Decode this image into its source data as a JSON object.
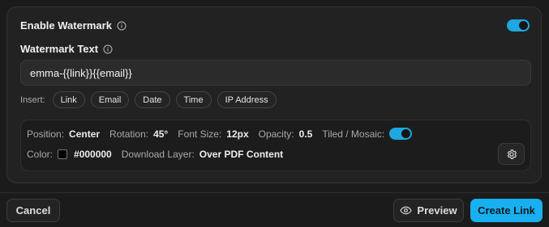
{
  "watermark": {
    "enable_label": "Enable Watermark",
    "enabled": true,
    "text_label": "Watermark Text",
    "text_value": "emma-{{link}}{{email}}",
    "insert_label": "Insert:",
    "insert_chips": [
      "Link",
      "Email",
      "Date",
      "Time",
      "IP Address"
    ]
  },
  "settings": {
    "position_label": "Position:",
    "position_value": "Center",
    "rotation_label": "Rotation:",
    "rotation_value": "45°",
    "font_size_label": "Font Size:",
    "font_size_value": "12px",
    "opacity_label": "Opacity:",
    "opacity_value": "0.5",
    "tiled_label": "Tiled / Mosaic:",
    "tiled_enabled": true,
    "color_label": "Color:",
    "color_value": "#000000",
    "download_layer_label": "Download Layer:",
    "download_layer_value": "Over PDF Content"
  },
  "footer": {
    "cancel_label": "Cancel",
    "preview_label": "Preview",
    "create_label": "Create Link"
  },
  "colors": {
    "accent": "#18b0f0",
    "background": "#1b1b1b",
    "card": "#222222"
  },
  "icons": [
    "info-icon",
    "gear-icon",
    "eye-icon"
  ]
}
